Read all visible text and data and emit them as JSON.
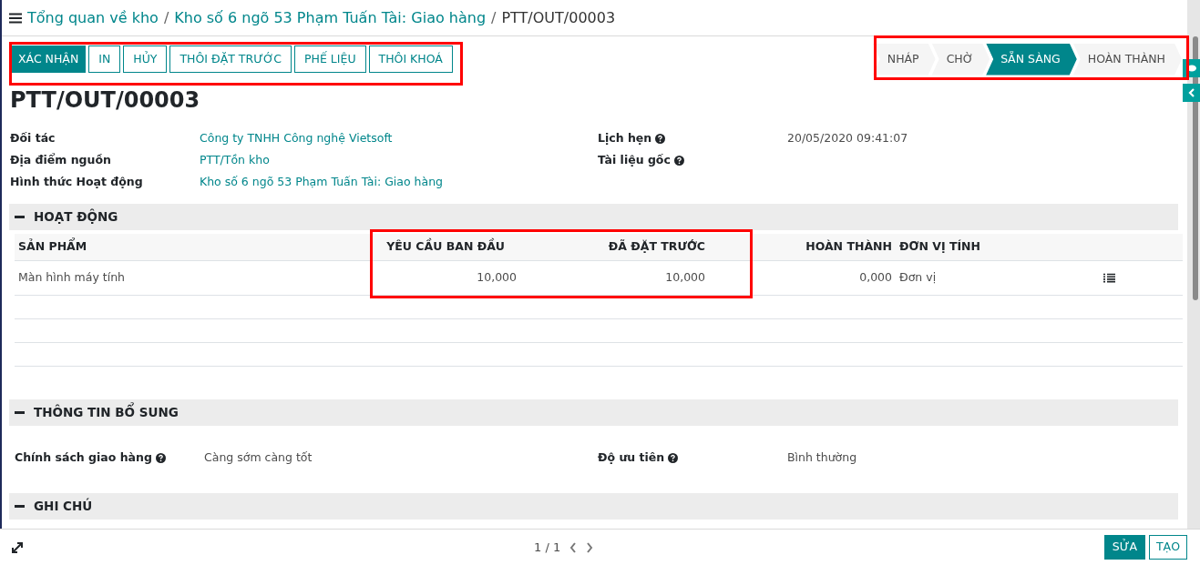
{
  "breadcrumb": [
    {
      "text": "Tổng quan về kho",
      "kind": "link"
    },
    {
      "separator": "/",
      "text": "Kho số 6 ngõ 53 Phạm Tuấn Tài: Giao hàng",
      "kind": "link"
    },
    {
      "separator": "/",
      "text": "PTT/OUT/00003",
      "kind": "current"
    }
  ],
  "actions": [
    {
      "label": "XÁC NHẬN",
      "primary": true
    },
    {
      "label": "IN",
      "primary": false
    },
    {
      "label": "HỦY",
      "primary": false
    },
    {
      "label": "THÔI ĐẶT TRƯỚC",
      "primary": false
    },
    {
      "label": "PHẾ LIỆU",
      "primary": false
    },
    {
      "label": "THÔI KHOÁ",
      "primary": false
    }
  ],
  "statuses": [
    {
      "label": "NHÁP",
      "selected": false
    },
    {
      "label": "CHỜ",
      "selected": false
    },
    {
      "label": "SẴN SÀNG",
      "selected": true
    },
    {
      "label": "HOÀN THÀNH",
      "selected": false
    }
  ],
  "title": "PTT/OUT/00003",
  "fields_left": [
    {
      "label": "Đối tác",
      "value": "Công ty TNHH Công nghệ Vietsoft",
      "link": true
    },
    {
      "label": "Địa điểm nguồn",
      "value": "PTT/Tồn kho",
      "link": true
    },
    {
      "label": "Hình thức Hoạt động",
      "value": "Kho số 6 ngõ 53 Phạm Tuấn Tài: Giao hàng",
      "link": true
    }
  ],
  "fields_right": [
    {
      "label": "Lịch hẹn",
      "value": "20/05/2020 09:41:07",
      "link": false,
      "help": true
    },
    {
      "label": "Tài liệu gốc",
      "help": true
    }
  ],
  "section_operations": {
    "title": "HOẠT ĐỘNG",
    "table": {
      "columns": [
        "SẢN PHẨM",
        "YÊU CẦU BAN ĐẦU",
        "ĐÃ ĐẶT TRƯỚC",
        "HOÀN THÀNH",
        "ĐƠN VỊ TÍNH"
      ],
      "rows": [
        {
          "cells": [
            "Màn hình máy tính",
            "10,000",
            "10,000",
            "0,000",
            "Đơn vị"
          ]
        }
      ]
    }
  },
  "section_extra": {
    "title": "THÔNG TIN BỔ SUNG",
    "fields_left": [
      {
        "label": "Chính sách giao hàng",
        "value": "Càng sớm càng tốt",
        "help": true
      }
    ],
    "fields_right": [
      {
        "label": "Độ ưu tiên",
        "value": "Bình thường",
        "help": true
      }
    ]
  },
  "section_notes": {
    "title": "GHI CHÚ"
  },
  "pager": "1 / 1",
  "footer_buttons": [
    {
      "label": "SỬA",
      "primary": true
    },
    {
      "label": "TẠO",
      "primary": false
    }
  ]
}
